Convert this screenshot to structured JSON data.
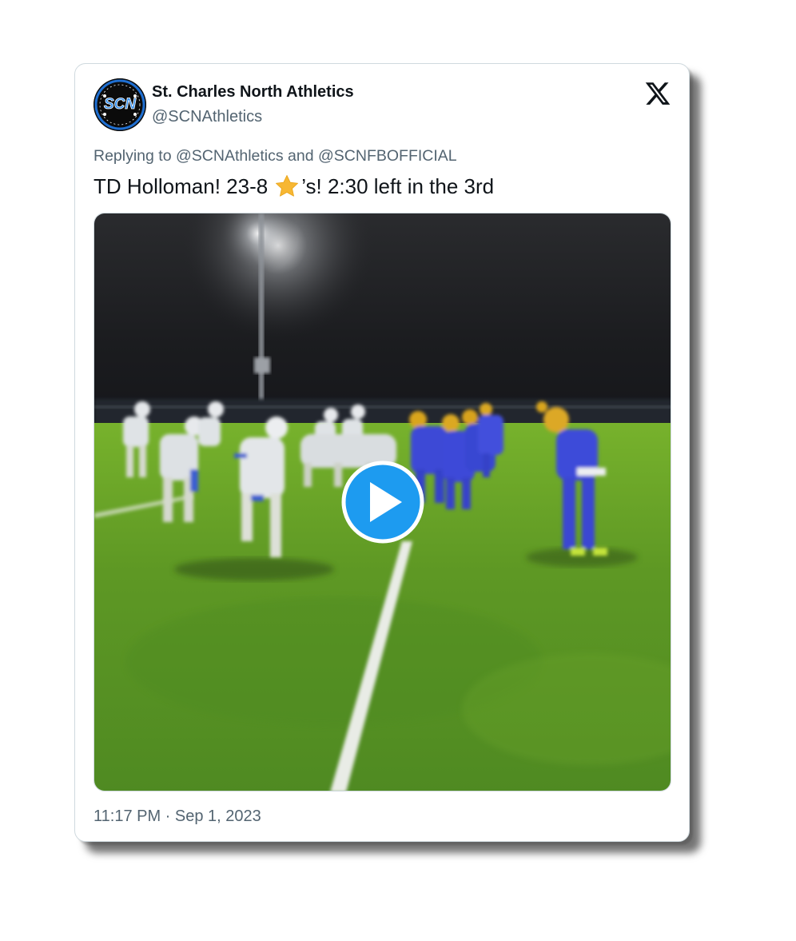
{
  "tweet": {
    "author_name": "St. Charles North Athletics",
    "author_handle": "@SCNAthletics",
    "avatar_text": "SCN",
    "reply_line": "Replying to @SCNAthletics and @SCNFBOFFICIAL",
    "text_before_emoji": "TD Holloman! 23-8",
    "emoji": "star-emoji",
    "text_after_emoji": "’s! 2:30 left in the 3rd",
    "timestamp": "11:17 PM · Sep 1, 2023"
  },
  "icons": {
    "brand": "x-logo-icon",
    "media_overlay": "play-icon"
  },
  "colors": {
    "name_text": "#0f1419",
    "secondary_text": "#536471",
    "play_button": "#1d9bf0",
    "avatar_ring": "#1f6fd1",
    "field_green": "#5f9a25"
  }
}
